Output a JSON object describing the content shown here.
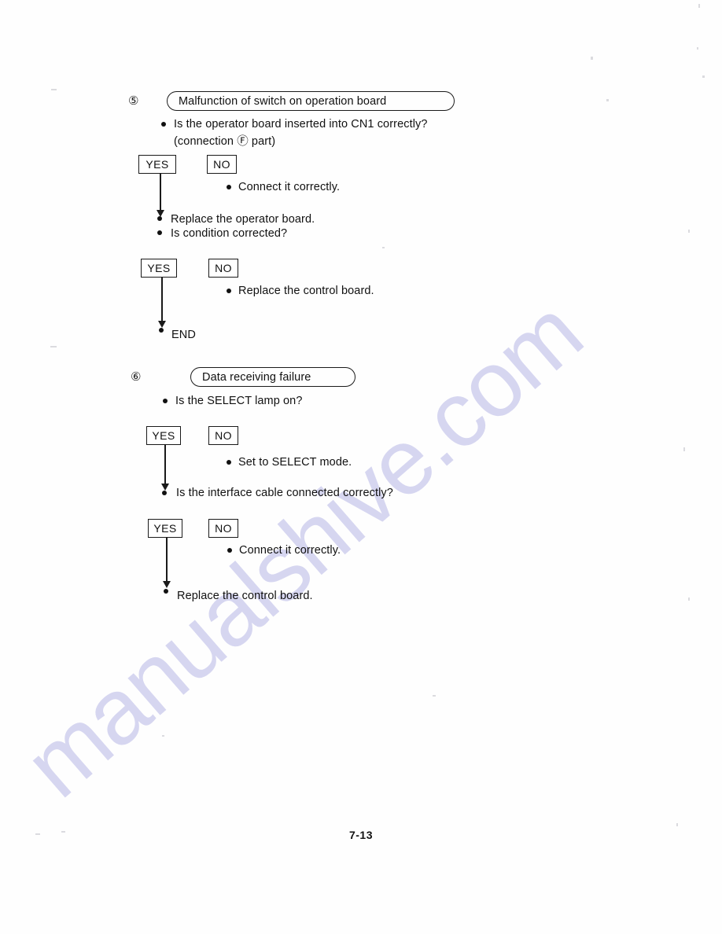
{
  "document": {
    "page_number": "7-13",
    "watermark": "manualshive.com"
  },
  "sections": [
    {
      "marker": "⑤",
      "title": "Malfunction of switch on operation board",
      "steps": [
        {
          "type": "question",
          "text": "Is the operator board inserted into CN1 correctly?"
        },
        {
          "type": "question_cont",
          "text": "(connection Ⓕ part)"
        },
        {
          "type": "decision",
          "yes": "YES",
          "no": "NO"
        },
        {
          "type": "action",
          "text": "Connect it correctly."
        },
        {
          "type": "action",
          "text": "Replace the operator board."
        },
        {
          "type": "question",
          "text": "Is condition corrected?"
        },
        {
          "type": "decision",
          "yes": "YES",
          "no": "NO"
        },
        {
          "type": "action",
          "text": "Replace the control board."
        },
        {
          "type": "terminal",
          "text": "END"
        }
      ]
    },
    {
      "marker": "⑥",
      "title": "Data receiving failure",
      "steps": [
        {
          "type": "question",
          "text": "Is the SELECT lamp on?"
        },
        {
          "type": "decision",
          "yes": "YES",
          "no": "NO"
        },
        {
          "type": "action",
          "text": "Set to SELECT mode."
        },
        {
          "type": "question",
          "text": "Is the interface cable connected correctly?"
        },
        {
          "type": "decision",
          "yes": "YES",
          "no": "NO"
        },
        {
          "type": "action",
          "text": "Connect it correctly."
        },
        {
          "type": "action",
          "text": "Replace the control board."
        }
      ]
    }
  ]
}
